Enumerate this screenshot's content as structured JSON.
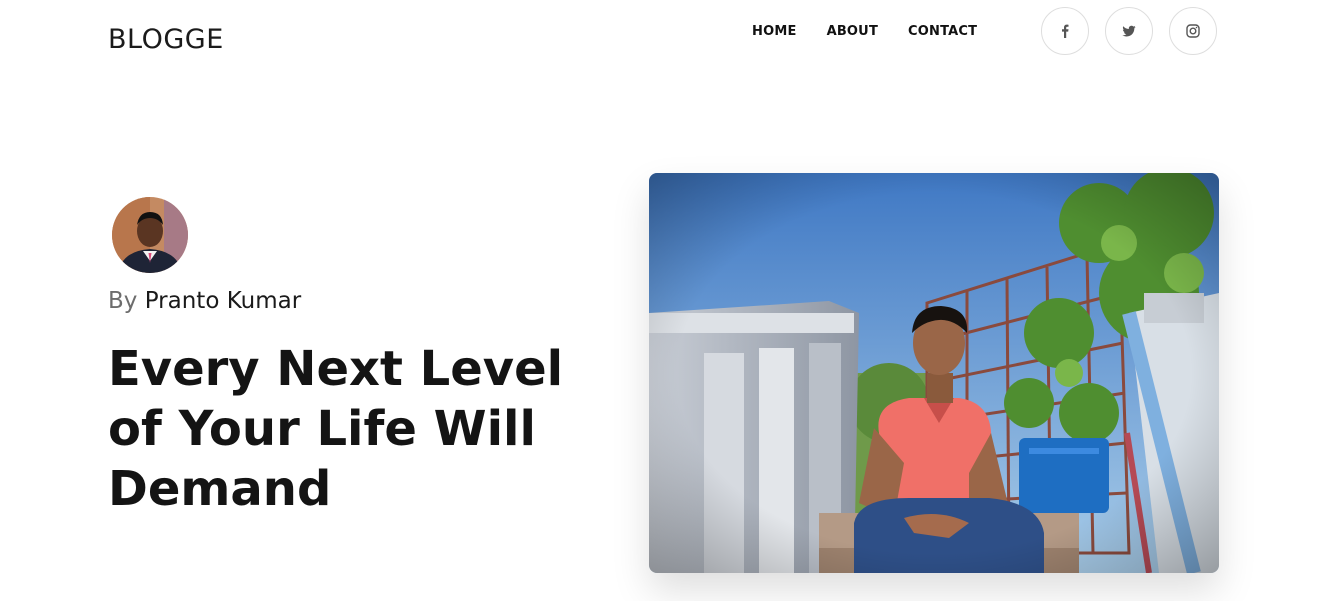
{
  "header": {
    "logo": "BLOGGE",
    "nav": [
      {
        "label": "HOME"
      },
      {
        "label": "ABOUT"
      },
      {
        "label": "CONTACT"
      }
    ],
    "social": [
      {
        "icon": "facebook-icon"
      },
      {
        "icon": "twitter-icon"
      },
      {
        "icon": "instagram-icon"
      }
    ]
  },
  "post": {
    "by_prefix": "By",
    "author": "Pranto Kumar",
    "title": "Every Next Level of Your Life Will Demand"
  }
}
